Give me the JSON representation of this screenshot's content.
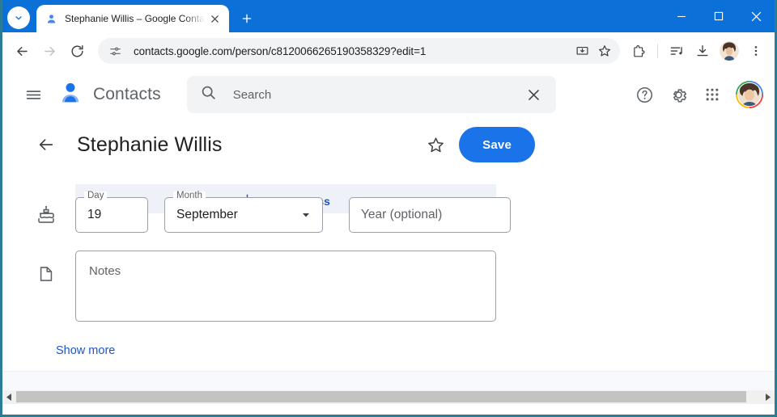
{
  "window": {
    "minimize_label": "Minimize",
    "maximize_label": "Maximize",
    "close_label": "Close"
  },
  "browser": {
    "tab_search_label": "Search tabs",
    "tab": {
      "title": "Stephanie Willis – Google Conta",
      "favicon": "contacts-person-icon",
      "close_label": "Close tab"
    },
    "new_tab_label": "New tab",
    "back_label": "Back",
    "forward_label": "Forward",
    "reload_label": "Reload",
    "omnibox": {
      "url": "contacts.google.com/person/c8120066265190358329?edit=1",
      "site_info_label": "View site information",
      "install_label": "Install",
      "bookmark_label": "Bookmark this tab"
    },
    "toolbar_icons": [
      {
        "name": "extensions-icon",
        "label": "Extensions"
      },
      {
        "name": "media-playlist-icon",
        "label": "Media"
      },
      {
        "name": "downloads-icon",
        "label": "Downloads"
      },
      {
        "name": "profile-avatar",
        "label": "Profile"
      },
      {
        "name": "chrome-menu-icon",
        "label": "Customize and control Google Chrome"
      }
    ]
  },
  "app": {
    "menu_label": "Main menu",
    "logo_icon": "contacts-person-icon",
    "title": "Contacts",
    "search": {
      "placeholder": "Search",
      "value": "",
      "search_icon": "search-icon",
      "clear_label": "Clear search"
    },
    "actions": [
      {
        "name": "help-icon",
        "label": "Support"
      },
      {
        "name": "gear-icon",
        "label": "Settings"
      },
      {
        "name": "apps-grid-icon",
        "label": "Google apps"
      }
    ],
    "account_avatar_label": "Google Account"
  },
  "contact": {
    "back_label": "Back",
    "name": "Stephanie Willis",
    "star_label": "Add to favorites",
    "save_label": "Save",
    "add_address_label": "Add address",
    "birthday": {
      "icon": "cake-icon",
      "day": {
        "label": "Day",
        "value": "19"
      },
      "month": {
        "label": "Month",
        "value": "September",
        "chevron": "chevron-down-icon"
      },
      "year": {
        "label": "",
        "placeholder": "Year (optional)",
        "value": ""
      }
    },
    "notes": {
      "icon": "note-icon",
      "placeholder": "Notes",
      "value": ""
    },
    "show_more_label": "Show more"
  },
  "scrollbar": {
    "left_label": "Scroll left",
    "right_label": "Scroll right"
  },
  "colors": {
    "titlebar": "#0b71d8",
    "accent": "#1a73e8",
    "link": "#1a56c5",
    "window_border": "#2b7d95",
    "panel": "#eef1f8"
  }
}
